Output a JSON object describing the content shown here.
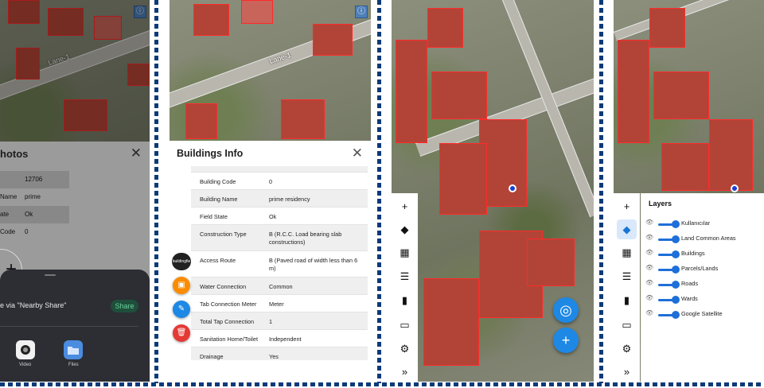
{
  "map": {
    "lane_label": "Lane-1"
  },
  "panel1": {
    "title": "hotos",
    "close_icon": "close-icon",
    "rows": [
      {
        "key": "",
        "value": "12706"
      },
      {
        "key": "Name",
        "value": "prime residency"
      },
      {
        "key": "ate",
        "value": "Ok"
      },
      {
        "key": "Code",
        "value": "0"
      }
    ],
    "add_icon": "+",
    "share": {
      "nearby_text": "e via \"Nearby Share\"",
      "share_button": "Share",
      "apps": [
        {
          "label": "Video",
          "icon": "video-icon"
        },
        {
          "label": "Files",
          "icon": "folder-icon"
        }
      ]
    }
  },
  "panel2": {
    "title": "Buildings Info",
    "close_icon": "close-icon",
    "rows": [
      {
        "key": "Building Code",
        "value": "0"
      },
      {
        "key": "Building Name",
        "value": "prime residency"
      },
      {
        "key": "Field State",
        "value": "Ok"
      },
      {
        "key": "Construction Type",
        "value": "B (R.C.C. Load bearing slab constructions)"
      },
      {
        "key": "Access Route",
        "value": "B (Paved road of width less than 6 m)"
      },
      {
        "key": "Water Connection",
        "value": "Common"
      },
      {
        "key": "Tab Connection Meter",
        "value": "Meter"
      },
      {
        "key": "Total Tap Connection",
        "value": "1"
      },
      {
        "key": "Sanitation Home/Toilet",
        "value": "Independent"
      },
      {
        "key": "Drainage",
        "value": "Yes"
      }
    ],
    "fab_label": "buildingfie",
    "colors": {
      "dark": "#222222",
      "orange": "#fb8c00",
      "blue": "#1e88e5",
      "red": "#e53935"
    }
  },
  "panel3": {
    "toolbar_icons": [
      "plus-icon",
      "layers-icon",
      "table-icon",
      "list-icon",
      "bookmark-icon",
      "ruler-icon",
      "gear-icon",
      "chevron-double-right-icon"
    ],
    "toolbar_glyphs": [
      "+",
      "◆",
      "▦",
      "☰",
      "▮",
      "▭",
      "⚙",
      "»"
    ]
  },
  "panel4": {
    "layers_title": "Layers",
    "layers": [
      "Kullanıcılar",
      "Land Common Areas",
      "Buildings",
      "Parcels/Lands",
      "Roads",
      "Wards",
      "Google Satellite"
    ]
  }
}
